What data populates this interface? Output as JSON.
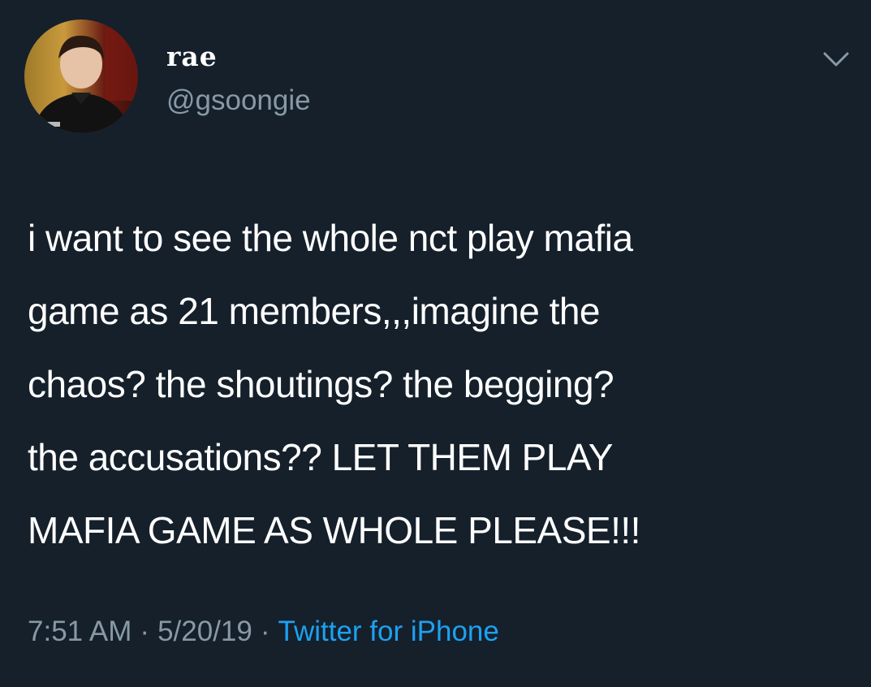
{
  "tweet": {
    "display_name": "rae",
    "handle": "@gsoongie",
    "text_lines": [
      "i want to see the whole nct play mafia",
      "game as 21 members,,,imagine the",
      "chaos? the shoutings? the begging?",
      "the accusations?? LET THEM PLAY",
      "MAFIA GAME AS WHOLE PLEASE!!!"
    ],
    "time": "7:51 AM",
    "separator": "·",
    "date": "5/20/19",
    "source": "Twitter for iPhone"
  },
  "icons": {
    "avatar": "profile-photo",
    "menu": "chevron-down-icon"
  },
  "colors": {
    "background": "#15202b",
    "primary_text": "#ffffff",
    "secondary_text": "#8899a6",
    "link": "#1da1f2"
  }
}
